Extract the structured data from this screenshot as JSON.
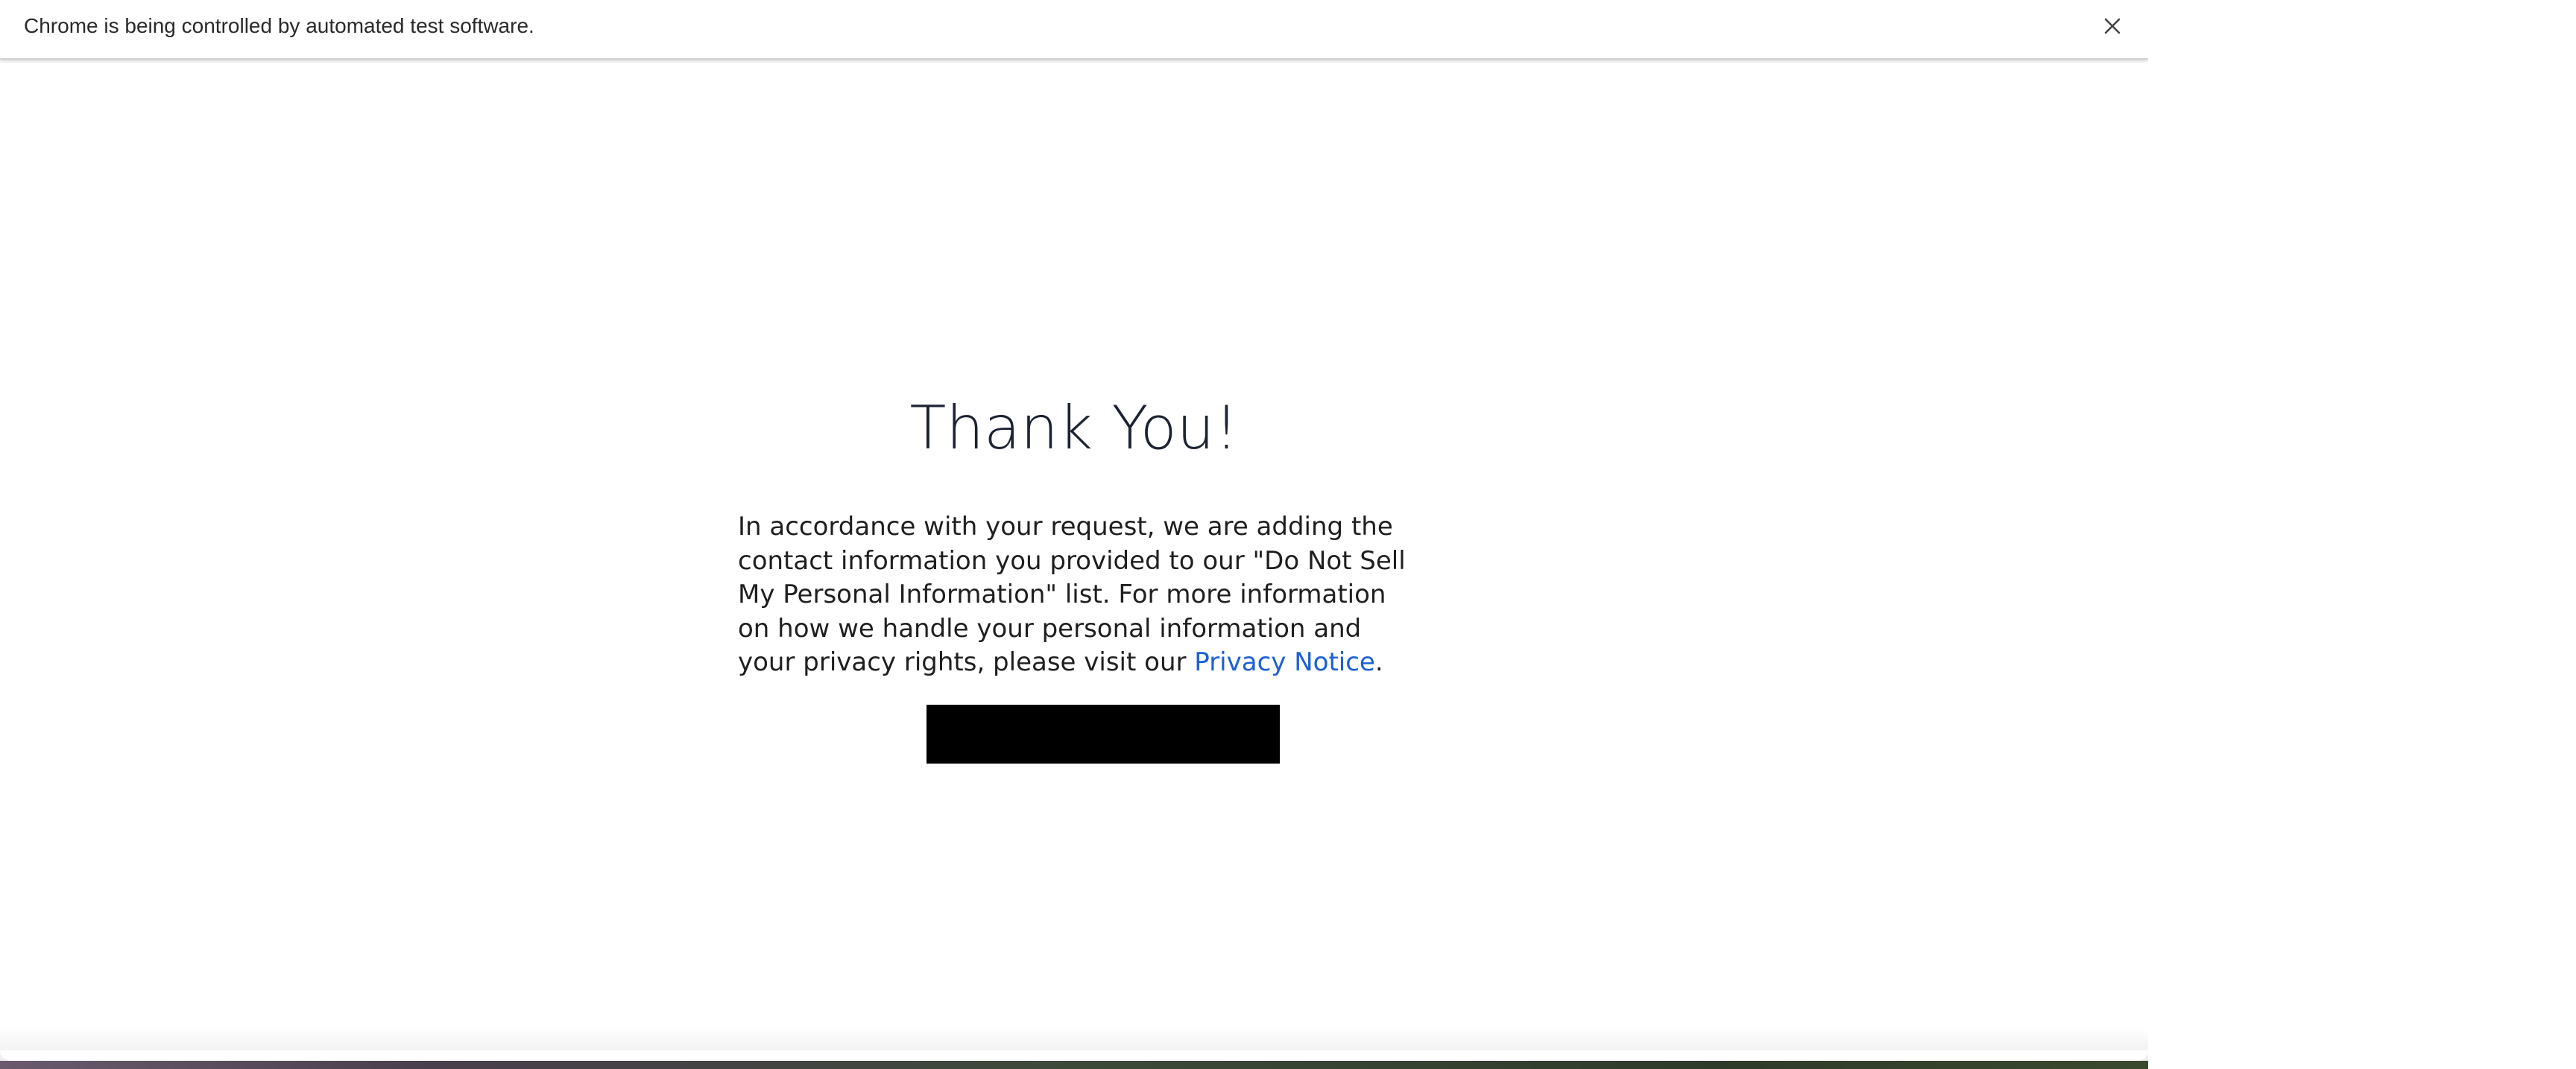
{
  "infobar": {
    "message": "Chrome is being controlled by automated test software.",
    "close_icon": "close-icon"
  },
  "page": {
    "heading": "Thank You!",
    "body_before_link": "In accordance with your request, we are adding the contact information you provided to our \"Do Not Sell My Personal Information\" list. For more information on how we handle your personal information and your privacy rights, please visit our ",
    "link_text": "Privacy Notice",
    "body_after_link": ".",
    "link_color": "#1a5fd6",
    "button_color": "#000000"
  }
}
